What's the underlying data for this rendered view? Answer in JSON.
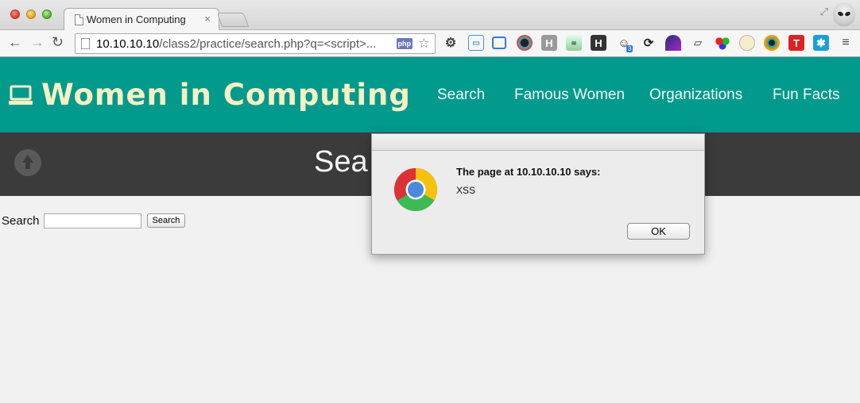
{
  "browser": {
    "tab_title": "Women in Computing",
    "tab_close": "×",
    "url_host": "10.10.10.10",
    "url_rest": "/class2/practice/search.php?q=<script>...",
    "php_badge": "php",
    "extension_badge_count": "3"
  },
  "site": {
    "logo_text": "Women in Computing",
    "nav": [
      "Search",
      "Famous Women",
      "Organizations",
      "Fun Facts"
    ],
    "banner_title": "Sea"
  },
  "search": {
    "label": "Search",
    "input_value": "",
    "button_label": "Search"
  },
  "dialog": {
    "heading": "The page at 10.10.10.10 says:",
    "message": "XSS",
    "ok_label": "OK"
  },
  "colors": {
    "header_bg": "#029a8c",
    "logo_text": "#f6f1c4",
    "banner_bg": "#3b3b3b"
  }
}
